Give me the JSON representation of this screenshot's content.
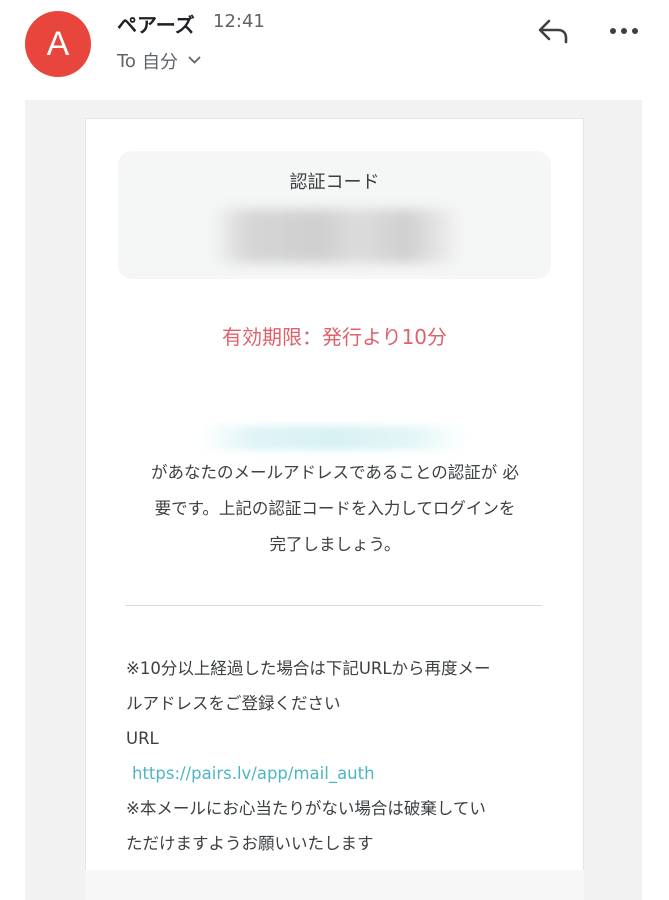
{
  "header": {
    "avatar_letter": "A",
    "sender": "ペアーズ",
    "time": "12:41",
    "recipient_prefix": "To",
    "recipient": "自分",
    "colors": {
      "avatar": "#e8453c"
    },
    "icons": {
      "reply": "reply-icon",
      "more": "more-icon",
      "expand": "chevron-down-icon"
    }
  },
  "email": {
    "code_title": "認証コード",
    "expiry": "有効期限：発行より10分",
    "body_lines": [
      "があなたのメールアドレスであることの認証が 必",
      "要です。上記の認証コードを入力してログインを",
      "完了しましょう。"
    ],
    "note_lines": [
      "※10分以上経過した場合は下記URLから再度メー",
      "ルアドレスをご登録ください"
    ],
    "url_label": "URL",
    "url": "https://pairs.lv/app/mail_auth",
    "footer_lines": [
      "※本メールにお心当たりがない場合は破棄してい",
      "ただけますようお願いいたします"
    ],
    "colors": {
      "expiry": "#e0606b",
      "link": "#4db6c4"
    }
  }
}
